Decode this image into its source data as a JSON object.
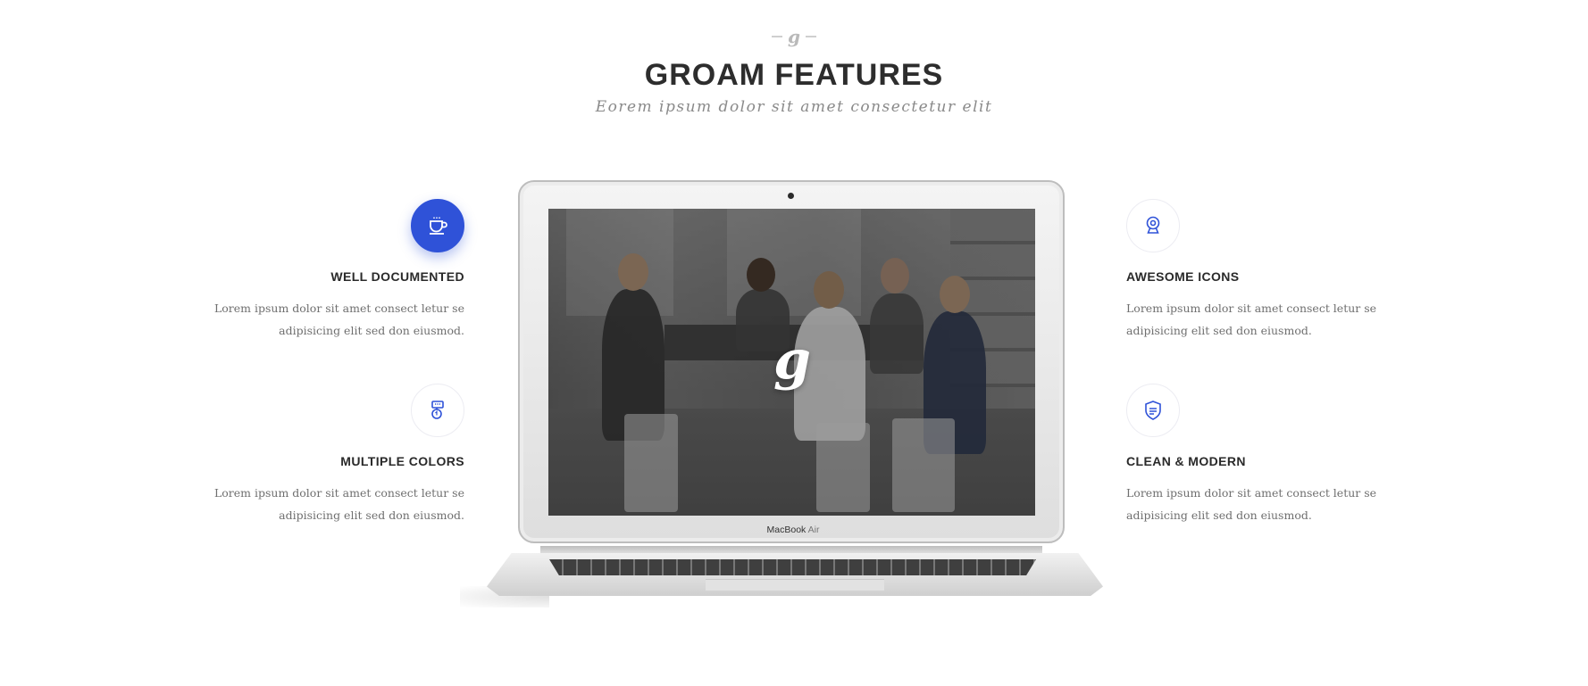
{
  "header": {
    "logo_letter": "g",
    "title": "GROAM FEATURES",
    "subtitle": "Eorem ipsum dolor sit amet consectetur elit"
  },
  "features": {
    "well_documented": {
      "icon": "cup-icon",
      "title": "WELL DOCUMENTED",
      "line1": "Lorem ipsum dolor sit amet consect letur se",
      "line2": "adipisicing elit sed don eiusmod."
    },
    "multiple_colors": {
      "icon": "badge-icon",
      "title": "MULTIPLE COLORS",
      "line1": "Lorem ipsum dolor sit amet consect letur se",
      "line2": "adipisicing elit sed don eiusmod."
    },
    "awesome_icons": {
      "icon": "webcam-icon",
      "title": "AWESOME ICONS",
      "line1": "Lorem ipsum dolor sit amet consect letur se",
      "line2": "adipisicing elit sed don eiusmod."
    },
    "clean_modern": {
      "icon": "shield-icon",
      "title": "CLEAN & MODERN",
      "line1": "Lorem ipsum dolor sit amet consect letur se",
      "line2": "adipisicing elit sed don eiusmod."
    }
  },
  "laptop": {
    "screen_logo": "g",
    "brand_main": "MacBook",
    "brand_light": "Air"
  },
  "colors": {
    "accent": "#2f52d8",
    "title": "#2d2d2d",
    "body_text": "#6f6f6f"
  }
}
